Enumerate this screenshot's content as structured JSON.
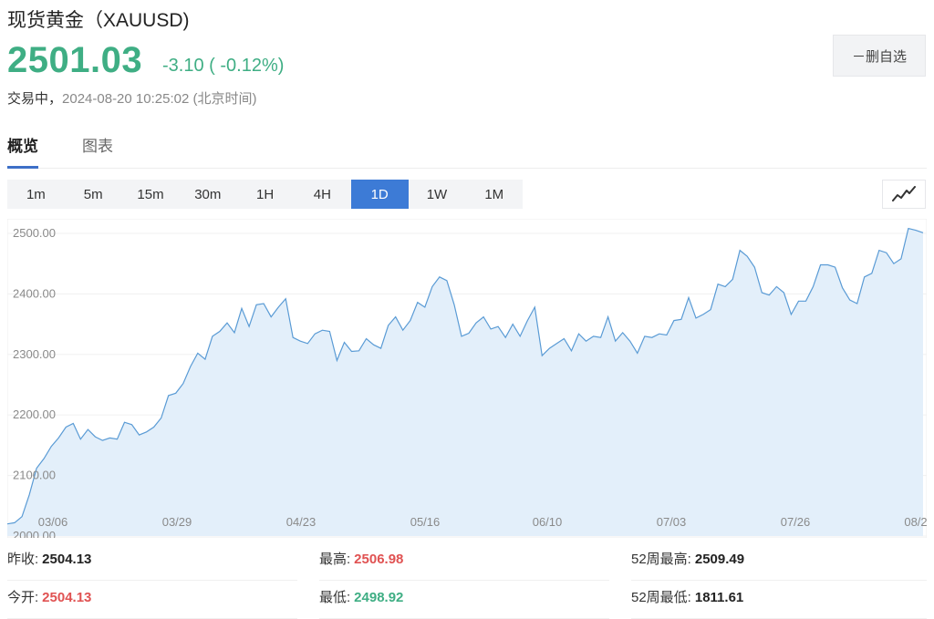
{
  "header": {
    "title": "现货黄金（XAUUSD)",
    "price": "2501.03",
    "change": "-3.10 ( -0.12%)",
    "status_label": "交易中，",
    "timestamp": "2024-08-20 10:25:02 (北京时间)",
    "remove_button": "－删自选"
  },
  "tabs": [
    {
      "label": "概览",
      "active": true
    },
    {
      "label": "图表",
      "active": false
    }
  ],
  "periods": [
    {
      "label": "1m"
    },
    {
      "label": "5m"
    },
    {
      "label": "15m"
    },
    {
      "label": "30m"
    },
    {
      "label": "1H"
    },
    {
      "label": "4H"
    },
    {
      "label": "1D",
      "active": true
    },
    {
      "label": "1W"
    },
    {
      "label": "1M"
    }
  ],
  "chart_type_icon": "line-chart-icon",
  "colors": {
    "up_green": "#3fae84",
    "down_red": "#e05252",
    "accent_blue": "#3d7bd6",
    "line": "#5a9bd5",
    "area_fill": "#e3effa"
  },
  "chart_data": {
    "type": "area",
    "y_ticks": [
      "2000.00",
      "2100.00",
      "2200.00",
      "2300.00",
      "2400.00",
      "2500.00"
    ],
    "ylim": [
      2000,
      2515
    ],
    "x_ticks": [
      "03/06",
      "03/29",
      "04/23",
      "05/16",
      "06/10",
      "07/03",
      "07/26",
      "08/2"
    ],
    "series": [
      {
        "values": [
          2020,
          2022,
          2032,
          2068,
          2112,
          2128,
          2148,
          2162,
          2180,
          2186,
          2160,
          2176,
          2164,
          2158,
          2162,
          2160,
          2188,
          2184,
          2167,
          2172,
          2180,
          2195,
          2232,
          2236,
          2252,
          2280,
          2302,
          2292,
          2330,
          2338,
          2352,
          2336,
          2376,
          2346,
          2382,
          2384,
          2362,
          2378,
          2392,
          2328,
          2322,
          2318,
          2334,
          2340,
          2338,
          2290,
          2320,
          2305,
          2306,
          2326,
          2316,
          2310,
          2348,
          2362,
          2340,
          2356,
          2386,
          2378,
          2412,
          2428,
          2422,
          2382,
          2330,
          2335,
          2352,
          2362,
          2342,
          2346,
          2328,
          2350,
          2330,
          2356,
          2378,
          2298,
          2310,
          2318,
          2326,
          2306,
          2334,
          2322,
          2330,
          2328,
          2362,
          2322,
          2336,
          2322,
          2302,
          2330,
          2328,
          2334,
          2332,
          2356,
          2358,
          2394,
          2360,
          2366,
          2374,
          2416,
          2412,
          2424,
          2472,
          2462,
          2444,
          2402,
          2398,
          2412,
          2402,
          2366,
          2388,
          2388,
          2412,
          2448,
          2448,
          2444,
          2410,
          2390,
          2384,
          2428,
          2434,
          2472,
          2468,
          2450,
          2458,
          2508,
          2505,
          2501
        ]
      }
    ]
  },
  "stats": [
    {
      "label": "昨收:",
      "value": "2504.13",
      "tone": "neutral"
    },
    {
      "label": "最高:",
      "value": "2506.98",
      "tone": "red"
    },
    {
      "label": "52周最高:",
      "value": "2509.49",
      "tone": "neutral"
    },
    {
      "label": "今开:",
      "value": "2504.13",
      "tone": "red"
    },
    {
      "label": "最低:",
      "value": "2498.92",
      "tone": "green"
    },
    {
      "label": "52周最低:",
      "value": "1811.61",
      "tone": "neutral"
    }
  ]
}
